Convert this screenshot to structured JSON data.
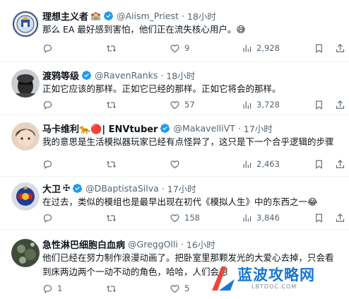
{
  "tweets": [
    {
      "name": "理想主义者",
      "extra": "🏫",
      "handle": "@Aiism_Priest",
      "dot": "·",
      "time": "18小时",
      "text": "那么 EA 最好感到害怕，他们正在流失核心用户。😅",
      "replies": "",
      "retweets": "",
      "likes": "9",
      "views": "2,928"
    },
    {
      "name": "渡鸦等级",
      "extra": "",
      "handle": "@RavenRanks",
      "dot": "·",
      "time": "18小时",
      "text": "正如它应该的那样。正如它已经的那样。正如它将会的那样。",
      "replies": "",
      "retweets": "",
      "likes": "57",
      "views": "3,728"
    },
    {
      "name": "马卡维利🐆🔴| ENVtuber",
      "extra": "",
      "handle": "@MakavelliVT",
      "dot": "·",
      "time": "17小时",
      "text": "我的意思是生活模拟器玩家已经有点怪异了，这只是下一个合乎逻辑的步骤",
      "replies": "",
      "retweets": "",
      "likes": "",
      "views": "2,463"
    },
    {
      "name": "大卫",
      "extra": "✠",
      "handle": "@DBaptistaSilva",
      "dot": "·",
      "time": "17小时",
      "text": "在过去，类似的模组也是最早出现在初代《模拟人生》中的东西之一😂",
      "replies": "",
      "retweets": "",
      "likes": "158",
      "views": "3,846"
    },
    {
      "name": "急性淋巴细胞白血病",
      "extra": "",
      "handle": "@GreggOlli",
      "dot": "·",
      "time": "16小时",
      "text": "他们已经在努力制作浪漫动画了。把卧室里那颗发光的大爱心去掉，只会看到床两边两个一动不动的角色，哈哈，人们会想",
      "replies": "1",
      "retweets": "",
      "likes": "5",
      "views": ""
    }
  ],
  "watermark": {
    "title": "蓝波攻略网",
    "sub": "LBTDOC.COM"
  },
  "colors": {
    "verified": "#1d9bf0",
    "muted": "#536471",
    "divider": "#eff3f4",
    "watermark": "#1677d7"
  },
  "icons": [
    "reply-icon",
    "retweet-icon",
    "like-icon",
    "views-icon",
    "bookmark-icon",
    "share-icon",
    "verified-badge-icon"
  ]
}
